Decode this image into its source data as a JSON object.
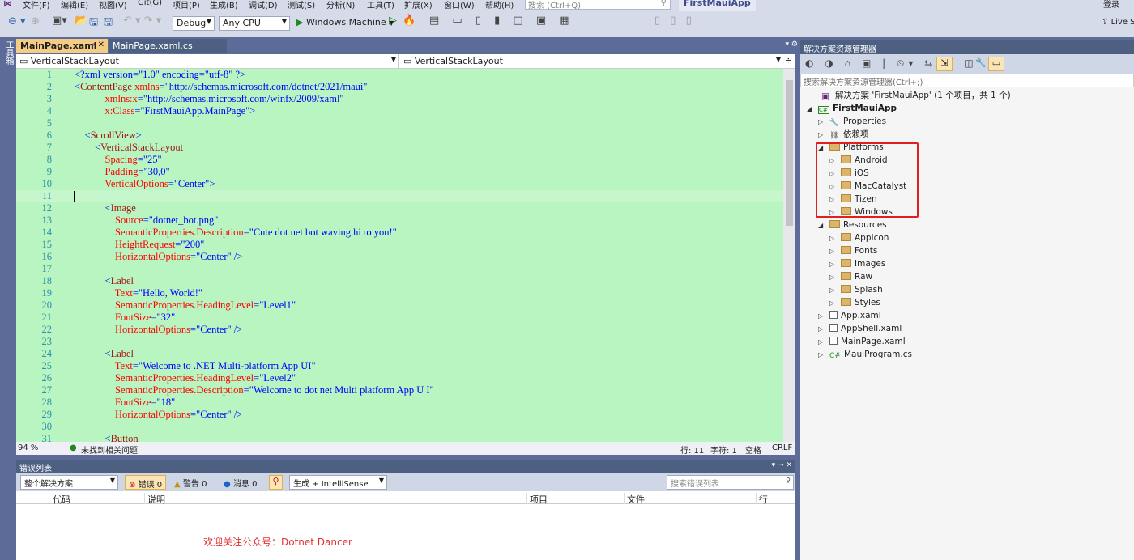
{
  "menu": [
    "文件(F)",
    "编辑(E)",
    "视图(V)",
    "Git(G)",
    "项目(P)",
    "生成(B)",
    "调试(D)",
    "测试(S)",
    "分析(N)",
    "工具(T)",
    "扩展(X)",
    "窗口(W)",
    "帮助(H)"
  ],
  "search_placeholder": "搜索 (Ctrl+Q)",
  "app_title": "FirstMauiApp",
  "login": "登录",
  "live_share": "Live Share",
  "toolbar": {
    "config": "Debug",
    "platform": "Any CPU",
    "run_target": "Windows Machine"
  },
  "toolbox_label": "工具箱",
  "tabs": [
    {
      "label": "MainPage.xaml",
      "active": true
    },
    {
      "label": "MainPage.xaml.cs",
      "active": false
    }
  ],
  "nav": {
    "left": "VerticalStackLayout",
    "right": "VerticalStackLayout"
  },
  "code_lines": [
    [
      [
        "p",
        "<?xml version=\"1.0\" encoding=\"utf-8\" ?>"
      ]
    ],
    [
      [
        "p",
        "<"
      ],
      [
        "t",
        "ContentPage"
      ],
      [
        "a",
        " xmlns"
      ],
      [
        "p",
        "="
      ],
      [
        "v",
        "\"http://schemas.microsoft.com/dotnet/2021/maui\""
      ]
    ],
    [
      [
        "p",
        "            "
      ],
      [
        "a",
        "xmlns:x"
      ],
      [
        "p",
        "="
      ],
      [
        "v",
        "\"http://schemas.microsoft.com/winfx/2009/xaml\""
      ]
    ],
    [
      [
        "p",
        "            "
      ],
      [
        "a",
        "x:Class"
      ],
      [
        "p",
        "="
      ],
      [
        "v",
        "\"FirstMauiApp.MainPage\""
      ],
      [
        "p",
        ">"
      ]
    ],
    [],
    [
      [
        "p",
        "    <"
      ],
      [
        "t",
        "ScrollView"
      ],
      [
        "p",
        ">"
      ]
    ],
    [
      [
        "p",
        "        <"
      ],
      [
        "t",
        "VerticalStackLayout"
      ]
    ],
    [
      [
        "p",
        "            "
      ],
      [
        "a",
        "Spacing"
      ],
      [
        "p",
        "="
      ],
      [
        "v",
        "\"25\""
      ]
    ],
    [
      [
        "p",
        "            "
      ],
      [
        "a",
        "Padding"
      ],
      [
        "p",
        "="
      ],
      [
        "v",
        "\"30,0\""
      ]
    ],
    [
      [
        "p",
        "            "
      ],
      [
        "a",
        "VerticalOptions"
      ],
      [
        "p",
        "="
      ],
      [
        "v",
        "\"Center\""
      ],
      [
        "p",
        ">"
      ]
    ],
    [],
    [
      [
        "p",
        "            <"
      ],
      [
        "t",
        "Image"
      ]
    ],
    [
      [
        "p",
        "                "
      ],
      [
        "a",
        "Source"
      ],
      [
        "p",
        "="
      ],
      [
        "v",
        "\"dotnet_bot.png\""
      ]
    ],
    [
      [
        "p",
        "                "
      ],
      [
        "a",
        "SemanticProperties.Description"
      ],
      [
        "p",
        "="
      ],
      [
        "v",
        "\"Cute dot net bot waving hi to you!\""
      ]
    ],
    [
      [
        "p",
        "                "
      ],
      [
        "a",
        "HeightRequest"
      ],
      [
        "p",
        "="
      ],
      [
        "v",
        "\"200\""
      ]
    ],
    [
      [
        "p",
        "                "
      ],
      [
        "a",
        "HorizontalOptions"
      ],
      [
        "p",
        "="
      ],
      [
        "v",
        "\"Center\""
      ],
      [
        "p",
        " />"
      ]
    ],
    [],
    [
      [
        "p",
        "            <"
      ],
      [
        "t",
        "Label"
      ]
    ],
    [
      [
        "p",
        "                "
      ],
      [
        "a",
        "Text"
      ],
      [
        "p",
        "="
      ],
      [
        "v",
        "\"Hello, World!\""
      ]
    ],
    [
      [
        "p",
        "                "
      ],
      [
        "a",
        "SemanticProperties.HeadingLevel"
      ],
      [
        "p",
        "="
      ],
      [
        "v",
        "\"Level1\""
      ]
    ],
    [
      [
        "p",
        "                "
      ],
      [
        "a",
        "FontSize"
      ],
      [
        "p",
        "="
      ],
      [
        "v",
        "\"32\""
      ]
    ],
    [
      [
        "p",
        "                "
      ],
      [
        "a",
        "HorizontalOptions"
      ],
      [
        "p",
        "="
      ],
      [
        "v",
        "\"Center\""
      ],
      [
        "p",
        " />"
      ]
    ],
    [],
    [
      [
        "p",
        "            <"
      ],
      [
        "t",
        "Label"
      ]
    ],
    [
      [
        "p",
        "                "
      ],
      [
        "a",
        "Text"
      ],
      [
        "p",
        "="
      ],
      [
        "v",
        "\"Welcome to .NET Multi-platform App UI\""
      ]
    ],
    [
      [
        "p",
        "                "
      ],
      [
        "a",
        "SemanticProperties.HeadingLevel"
      ],
      [
        "p",
        "="
      ],
      [
        "v",
        "\"Level2\""
      ]
    ],
    [
      [
        "p",
        "                "
      ],
      [
        "a",
        "SemanticProperties.Description"
      ],
      [
        "p",
        "="
      ],
      [
        "v",
        "\"Welcome to dot net Multi platform App U I\""
      ]
    ],
    [
      [
        "p",
        "                "
      ],
      [
        "a",
        "FontSize"
      ],
      [
        "p",
        "="
      ],
      [
        "v",
        "\"18\""
      ]
    ],
    [
      [
        "p",
        "                "
      ],
      [
        "a",
        "HorizontalOptions"
      ],
      [
        "p",
        "="
      ],
      [
        "v",
        "\"Center\""
      ],
      [
        "p",
        " />"
      ]
    ],
    [],
    [
      [
        "p",
        "            <"
      ],
      [
        "t",
        "Button"
      ]
    ]
  ],
  "status": {
    "zoom": "94 %",
    "issues": "未找到相关问题",
    "line": "行: 11",
    "col": "字符: 1",
    "spaces": "空格",
    "eol": "CRLF"
  },
  "error_list": {
    "title": "错误列表",
    "scope": "整个解决方案",
    "errors": "错误 0",
    "warnings": "警告 0",
    "messages": "消息 0",
    "build_filter": "生成 + IntelliSense",
    "search_placeholder": "搜索错误列表",
    "columns": [
      "代码",
      "说明",
      "项目",
      "文件",
      "行"
    ]
  },
  "watermark": "欢迎关注公众号：Dotnet Dancer",
  "solution_explorer": {
    "title": "解决方案资源管理器",
    "search_placeholder": "搜索解决方案资源管理器(Ctrl+;)",
    "tree": [
      {
        "label": "解决方案 'FirstMauiApp' (1 个项目，共 1 个)",
        "level": 0,
        "icon": "solution",
        "exp": ""
      },
      {
        "label": "FirstMauiApp",
        "level": 0,
        "icon": "csproj",
        "exp": "open",
        "bold": true
      },
      {
        "label": "Properties",
        "level": 1,
        "icon": "properties",
        "exp": "closed"
      },
      {
        "label": "依赖项",
        "level": 1,
        "icon": "dependencies",
        "exp": "closed"
      },
      {
        "label": "Platforms",
        "level": 1,
        "icon": "folder",
        "exp": "open"
      },
      {
        "label": "Android",
        "level": 2,
        "icon": "folder",
        "exp": "closed"
      },
      {
        "label": "iOS",
        "level": 2,
        "icon": "folder",
        "exp": "closed"
      },
      {
        "label": "MacCatalyst",
        "level": 2,
        "icon": "folder",
        "exp": "closed"
      },
      {
        "label": "Tizen",
        "level": 2,
        "icon": "folder",
        "exp": "closed"
      },
      {
        "label": "Windows",
        "level": 2,
        "icon": "folder",
        "exp": "closed"
      },
      {
        "label": "Resources",
        "level": 1,
        "icon": "folder",
        "exp": "open"
      },
      {
        "label": "AppIcon",
        "level": 2,
        "icon": "folder",
        "exp": "closed"
      },
      {
        "label": "Fonts",
        "level": 2,
        "icon": "folder",
        "exp": "closed"
      },
      {
        "label": "Images",
        "level": 2,
        "icon": "folder",
        "exp": "closed"
      },
      {
        "label": "Raw",
        "level": 2,
        "icon": "folder",
        "exp": "closed"
      },
      {
        "label": "Splash",
        "level": 2,
        "icon": "folder",
        "exp": "closed"
      },
      {
        "label": "Styles",
        "level": 2,
        "icon": "folder",
        "exp": "closed"
      },
      {
        "label": "App.xaml",
        "level": 1,
        "icon": "xaml-file",
        "exp": "closed"
      },
      {
        "label": "AppShell.xaml",
        "level": 1,
        "icon": "xaml-file",
        "exp": "closed"
      },
      {
        "label": "MainPage.xaml",
        "level": 1,
        "icon": "xaml-file",
        "exp": "closed"
      },
      {
        "label": "MauiProgram.cs",
        "level": 1,
        "icon": "csharp-file",
        "exp": "closed"
      }
    ]
  },
  "colors": {
    "editor_bg": "#b8f5c0",
    "active_tab": "#f5cc84",
    "highlight_box": "#e02020",
    "watermark": "#e03030"
  }
}
